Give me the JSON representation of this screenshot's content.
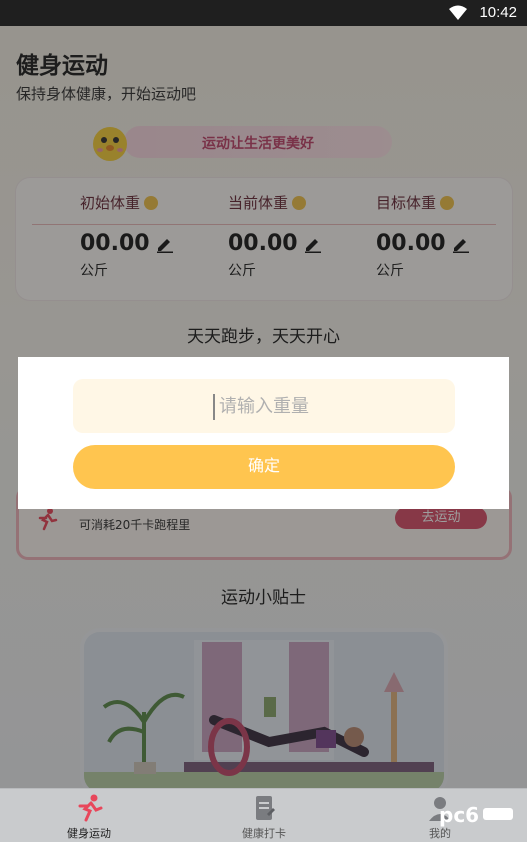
{
  "status_bar": {
    "time": "10:42"
  },
  "header": {
    "title": "健身运动",
    "subtitle": "保持身体健康，开始运动吧"
  },
  "banner": {
    "text": "运动让生活更美好"
  },
  "weights": [
    {
      "label": "初始体重",
      "value": "00.00",
      "unit": "公斤"
    },
    {
      "label": "当前体重",
      "value": "00.00",
      "unit": "公斤"
    },
    {
      "label": "目标体重",
      "value": "00.00",
      "unit": "公斤"
    }
  ],
  "run_section": {
    "title": "天天跑步，天天开心",
    "desc": "可消耗20千卡跑程里",
    "button": "去运动"
  },
  "tips_section": {
    "title": "运动小贴士"
  },
  "dialog": {
    "placeholder": "请输入重量",
    "confirm": "确定"
  },
  "tabbar": {
    "items": [
      {
        "label": "健身运动"
      },
      {
        "label": "健康打卡"
      },
      {
        "label": "我的"
      }
    ]
  },
  "watermark": {
    "text": "pc6"
  },
  "colors": {
    "accent": "#ffc54f",
    "input_bg": "#fff7e6",
    "run_icon": "#e8475b"
  }
}
